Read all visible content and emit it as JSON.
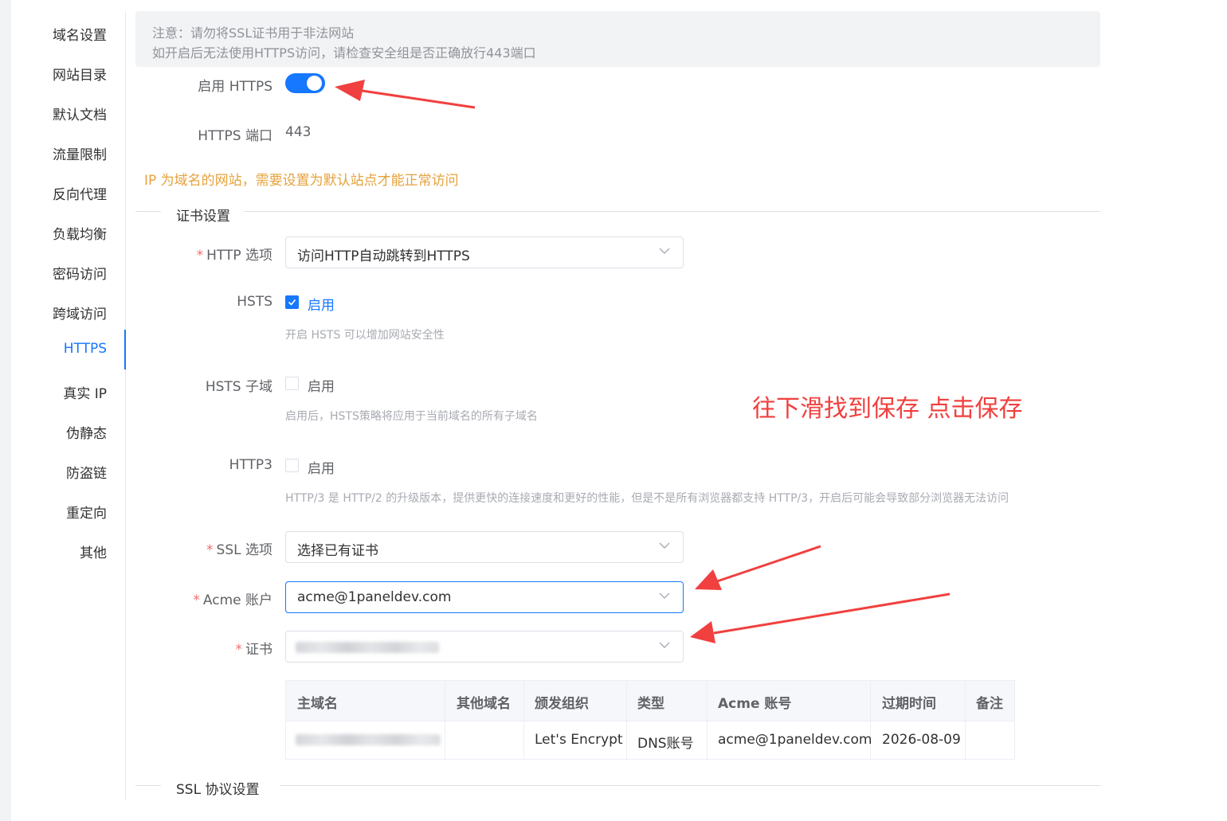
{
  "sidebar": {
    "items": [
      {
        "label": "域名设置"
      },
      {
        "label": "网站目录"
      },
      {
        "label": "默认文档"
      },
      {
        "label": "流量限制"
      },
      {
        "label": "反向代理"
      },
      {
        "label": "负载均衡"
      },
      {
        "label": "密码访问"
      },
      {
        "label": "跨域访问"
      },
      {
        "label": "HTTPS",
        "active": true
      },
      {
        "label": "真实 IP"
      },
      {
        "label": "伪静态"
      },
      {
        "label": "防盗链"
      },
      {
        "label": "重定向"
      },
      {
        "label": "其他"
      }
    ]
  },
  "notice": {
    "line1": "注意：请勿将SSL证书用于非法网站",
    "line2": "如开启后无法使用HTTPS访问，请检查安全组是否正确放行443端口"
  },
  "https": {
    "enable_label": "启用 HTTPS",
    "enabled": true,
    "port_label": "HTTPS 端口",
    "port_value": "443"
  },
  "ip_warning": "IP 为域名的网站，需要设置为默认站点才能正常访问",
  "cert_section": {
    "title": "证书设置",
    "required_mark": "*",
    "http_option": {
      "label": "HTTP 选项",
      "value": "访问HTTP自动跳转到HTTPS"
    },
    "hsts": {
      "label": "HSTS",
      "check_label": "启用",
      "checked": true,
      "hint": "开启 HSTS 可以增加网站安全性"
    },
    "hsts_sub": {
      "label": "HSTS 子域",
      "check_label": "启用",
      "checked": false,
      "hint": "启用后，HSTS策略将应用于当前域名的所有子域名"
    },
    "http3": {
      "label": "HTTP3",
      "check_label": "启用",
      "checked": false,
      "hint": "HTTP/3 是 HTTP/2 的升级版本，提供更快的连接速度和更好的性能，但是不是所有浏览器都支持 HTTP/3，开启后可能会导致部分浏览器无法访问"
    },
    "ssl_option": {
      "label": "SSL 选项",
      "value": "选择已有证书"
    },
    "acme_account": {
      "label": "Acme 账户",
      "value": "acme@1paneldev.com"
    },
    "certificate": {
      "label": "证书",
      "value": ""
    }
  },
  "cert_table": {
    "headers": [
      "主域名",
      "其他域名",
      "颁发组织",
      "类型",
      "Acme 账号",
      "过期时间",
      "备注"
    ],
    "row": [
      "",
      "",
      "Let's Encrypt",
      "DNS账号",
      "acme@1paneldev.com",
      "2026-08-09",
      ""
    ]
  },
  "ssl_protocol_section": {
    "title": "SSL 协议设置"
  },
  "annotation_text": "往下滑找到保存 点击保存",
  "colors": {
    "primary": "#1677ff",
    "warning": "#e6a23c",
    "annotation": "#f0403f",
    "required": "#f56c6c"
  }
}
